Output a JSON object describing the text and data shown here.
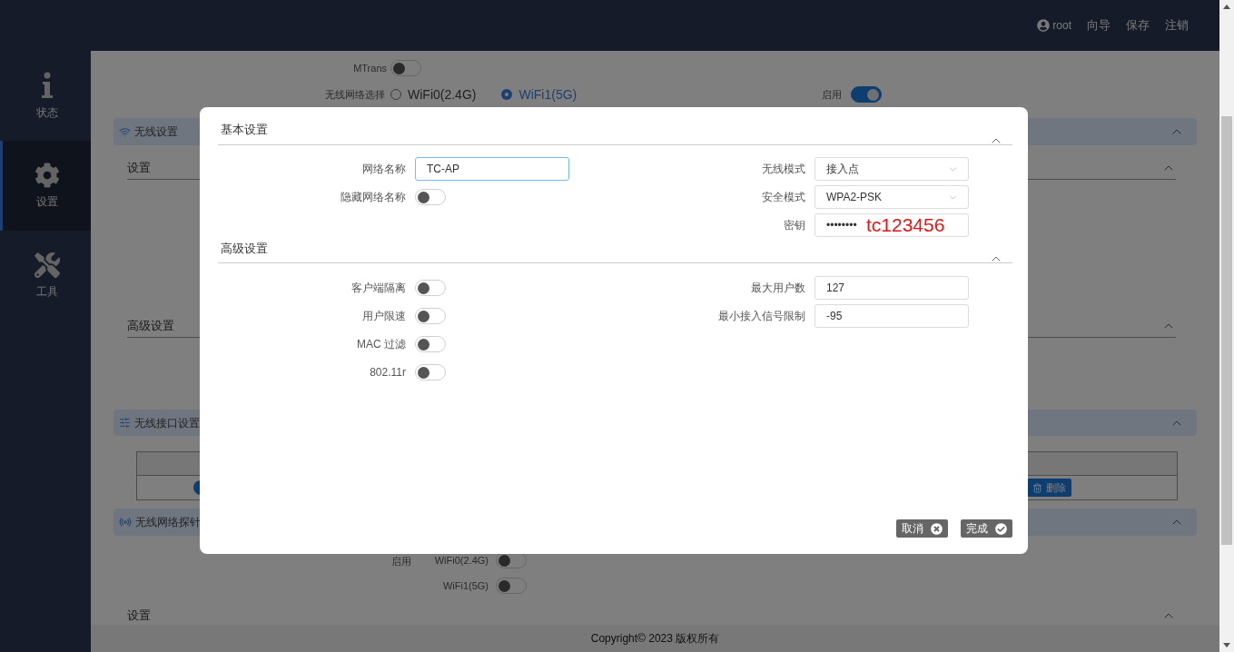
{
  "topbar": {
    "user": "root",
    "links": [
      "向导",
      "保存",
      "注销"
    ]
  },
  "sidebar": [
    {
      "label": "状态",
      "kind": "info",
      "selected": false
    },
    {
      "label": "设置",
      "kind": "gear",
      "selected": true
    },
    {
      "label": "工具",
      "kind": "tools",
      "selected": false
    }
  ],
  "background": {
    "mtrans": {
      "label": "MTrans",
      "on": false
    },
    "band_select": {
      "label": "无线网络选择",
      "options": [
        {
          "label": "WiFi0(2.4G)",
          "selected": false
        },
        {
          "label": "WiFi1(5G)",
          "selected": true
        }
      ]
    },
    "enable": {
      "label": "启用",
      "on": true
    },
    "wireless_settings": {
      "title": "无线设置",
      "expanded": true,
      "subsections": [
        {
          "title": "设置",
          "expanded": true
        },
        {
          "title": "高级设置",
          "expanded": true
        }
      ]
    },
    "interface_settings": {
      "title": "无线接口设置",
      "expanded": true,
      "delete_button": "删除"
    },
    "probe": {
      "title": "无线网络探针",
      "expanded": true,
      "enable_label": "启用",
      "toggles": [
        {
          "label": "WiFi0(2.4G)",
          "on": false
        },
        {
          "label": "WiFi1(5G)",
          "on": false
        }
      ],
      "subsection": {
        "title": "设置",
        "expanded": true
      }
    },
    "footer": "Copyright© 2023 版权所有"
  },
  "dialog": {
    "sections": [
      {
        "title": "基本设置",
        "expanded": true,
        "left": [
          {
            "kind": "text",
            "label": "网络名称",
            "value": "TC-AP",
            "focused": true
          },
          {
            "kind": "toggle",
            "label": "隐藏网络名称",
            "on": false
          }
        ],
        "right": [
          {
            "kind": "select",
            "label": "无线模式",
            "value": "接入点"
          },
          {
            "kind": "select",
            "label": "安全模式",
            "value": "WPA2-PSK"
          },
          {
            "kind": "password",
            "label": "密钥",
            "value": "••••••••",
            "annotation": "tc123456"
          }
        ]
      },
      {
        "title": "高级设置",
        "expanded": true,
        "left": [
          {
            "kind": "toggle",
            "label": "客户端隔离",
            "on": false
          },
          {
            "kind": "toggle",
            "label": "用户限速",
            "on": false
          },
          {
            "kind": "toggle",
            "label": "MAC 过滤",
            "on": false
          },
          {
            "kind": "toggle",
            "label": "802.11r",
            "on": false
          }
        ],
        "right": [
          {
            "kind": "text",
            "label": "最大用户数",
            "value": "127",
            "focused": false
          },
          {
            "kind": "text",
            "label": "最小接入信号限制",
            "value": "-95",
            "focused": false
          }
        ]
      }
    ],
    "buttons": [
      {
        "label": "取消",
        "kind": "cancel"
      },
      {
        "label": "完成",
        "kind": "confirm"
      }
    ]
  }
}
